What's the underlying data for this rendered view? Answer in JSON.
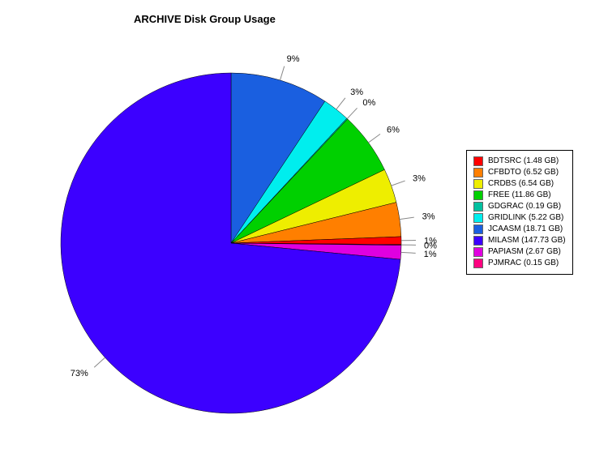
{
  "chart_data": {
    "type": "pie",
    "title": "ARCHIVE Disk Group Usage",
    "legend_position": "right",
    "series": [
      {
        "name": "BDTSRC",
        "gb": 1.48,
        "pct": 1,
        "color": "#ff0000"
      },
      {
        "name": "CFBDTO",
        "gb": 6.52,
        "pct": 3,
        "color": "#ff7f00"
      },
      {
        "name": "CRDBS",
        "gb": 6.54,
        "pct": 3,
        "color": "#eeee00"
      },
      {
        "name": "FREE",
        "gb": 11.86,
        "pct": 6,
        "color": "#00d000"
      },
      {
        "name": "GDGRAC",
        "gb": 0.19,
        "pct": 0,
        "color": "#00c0a0"
      },
      {
        "name": "GRIDLINK",
        "gb": 5.22,
        "pct": 3,
        "color": "#00eeee"
      },
      {
        "name": "JCAASM",
        "gb": 18.71,
        "pct": 9,
        "color": "#1a5fe0"
      },
      {
        "name": "MILASM",
        "gb": 147.73,
        "pct": 73,
        "color": "#3c00ff"
      },
      {
        "name": "PAPIASM",
        "gb": 2.67,
        "pct": 1,
        "color": "#e000e0"
      },
      {
        "name": "PJMRAC",
        "gb": 0.15,
        "pct": 0,
        "color": "#ff0080"
      }
    ]
  }
}
